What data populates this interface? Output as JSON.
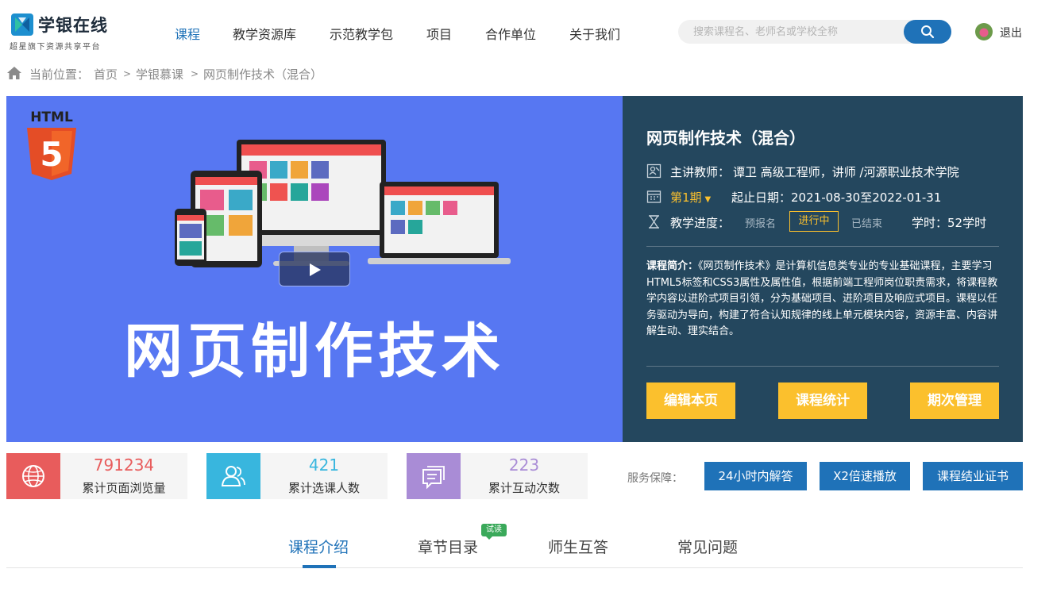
{
  "brand": {
    "name": "学银在线",
    "tagline": "超星旗下资源共享平台"
  },
  "nav": {
    "items": [
      {
        "label": "课程"
      },
      {
        "label": "教学资源库"
      },
      {
        "label": "示范教学包"
      },
      {
        "label": "项目"
      },
      {
        "label": "合作单位"
      },
      {
        "label": "关于我们"
      }
    ],
    "active_index": 0
  },
  "search": {
    "placeholder": "搜索课程名、老师名或学校全称",
    "value": ""
  },
  "user": {
    "logout_label": "退出"
  },
  "breadcrumb": {
    "prefix": "当前位置：",
    "items": [
      "首页",
      "学银慕课",
      "网页制作技术（混合）"
    ],
    "separator": ">"
  },
  "banner": {
    "badge_text": "HTML",
    "badge_number": "5",
    "title": "网页制作技术"
  },
  "course": {
    "title": "网页制作技术（混合）",
    "teacher_label": "主讲教师：",
    "teacher": "谭卫 高级工程师，讲师 /河源职业技术学院",
    "term": "第1期",
    "date_label": "起止日期：",
    "dates": "2021-08-30至2022-01-31",
    "progress_label": "教学进度：",
    "progress_steps": [
      "预报名",
      "进行中",
      "已结束"
    ],
    "progress_current": "进行中",
    "hours": "学时：52学时",
    "intro_label": "课程简介：",
    "intro": "《网页制作技术》是计算机信息类专业的专业基础课程，主要学习HTML5标签和CSS3属性及属性值，根据前端工程师岗位职责需求，将课程教学内容以进阶式项目引领，分为基础项目、进阶项目及响应式项目。课程以任务驱动为导向，构建了符合认知规律的线上单元模块内容，资源丰富、内容讲解生动、理实结合。",
    "buttons": [
      "编辑本页",
      "课程统计",
      "期次管理"
    ]
  },
  "stats": [
    {
      "value": "791234",
      "label": "累计页面浏览量",
      "icon": "globe-icon",
      "color": "#e85c5c"
    },
    {
      "value": "421",
      "label": "累计选课人数",
      "icon": "users-icon",
      "color": "#38b6de"
    },
    {
      "value": "223",
      "label": "累计互动次数",
      "icon": "chat-icon",
      "color": "#a98cd6"
    }
  ],
  "service": {
    "label": "服务保障：",
    "buttons": [
      "24小时内解答",
      "X2倍速播放",
      "课程结业证书"
    ]
  },
  "tabs": {
    "items": [
      "课程介绍",
      "章节目录",
      "师生互答",
      "常见问题"
    ],
    "active_index": 0,
    "badge": "试读"
  },
  "colors": {
    "accent": "#1f72b8",
    "panel": "#24475e",
    "banner": "#5777f2",
    "highlight": "#fbc02d"
  }
}
